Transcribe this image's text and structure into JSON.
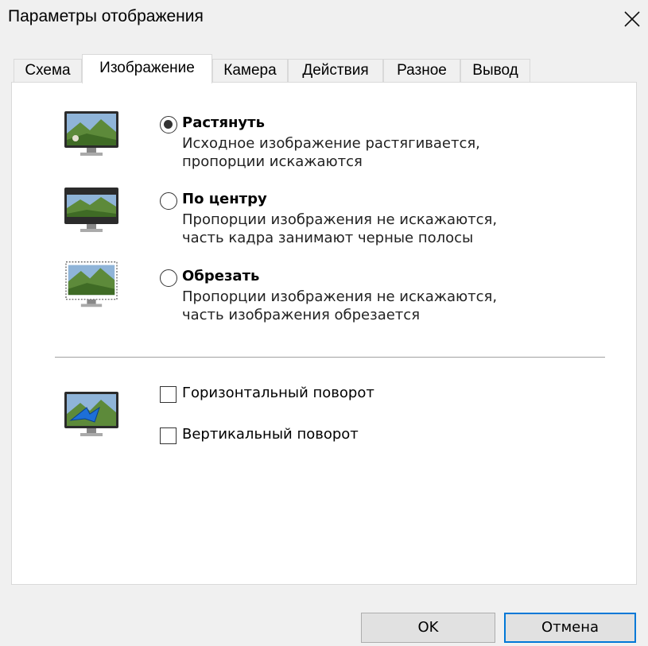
{
  "window": {
    "title": "Параметры отображения",
    "close_icon": "close-icon"
  },
  "tabs": [
    {
      "label": "Схема"
    },
    {
      "label": "Изображение",
      "active": true
    },
    {
      "label": "Камера"
    },
    {
      "label": "Действия"
    },
    {
      "label": "Разное"
    },
    {
      "label": "Вывод"
    }
  ],
  "scale_options": [
    {
      "label": "Растянуть",
      "desc1": "Исходное изображение растягивается,",
      "desc2": "пропорции искажаются",
      "checked": true,
      "icon": "monitor-stretch-icon"
    },
    {
      "label": "По центру",
      "desc1": "Пропорции изображения не искажаются,",
      "desc2": "часть кадра занимают черные полосы",
      "checked": false,
      "icon": "monitor-letterbox-icon"
    },
    {
      "label": "Обрезать",
      "desc1": "Пропорции изображения не искажаются,",
      "desc2": "часть изображения обрезается",
      "checked": false,
      "icon": "monitor-crop-icon"
    }
  ],
  "rotation": {
    "icon": "monitor-flip-icon",
    "horizontal_label": "Горизонтальный поворот",
    "horizontal_checked": false,
    "vertical_label": "Вертикальный поворот",
    "vertical_checked": false
  },
  "buttons": {
    "ok": "OK",
    "cancel": "Отмена"
  },
  "colors": {
    "accent": "#0078d7",
    "panel_bg": "#ffffff",
    "window_bg": "#f0f0f0"
  }
}
